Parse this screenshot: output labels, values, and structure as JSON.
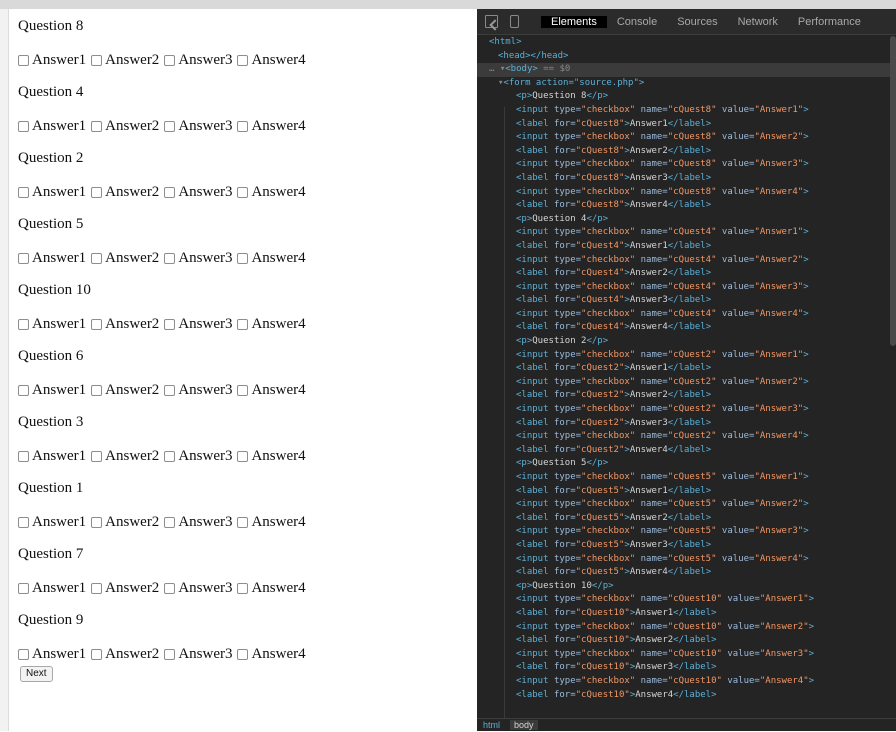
{
  "page": {
    "questions": [
      {
        "title": "Question 8",
        "answers": [
          "Answer1",
          "Answer2",
          "Answer3",
          "Answer4"
        ]
      },
      {
        "title": "Question 4",
        "answers": [
          "Answer1",
          "Answer2",
          "Answer3",
          "Answer4"
        ]
      },
      {
        "title": "Question 2",
        "answers": [
          "Answer1",
          "Answer2",
          "Answer3",
          "Answer4"
        ]
      },
      {
        "title": "Question 5",
        "answers": [
          "Answer1",
          "Answer2",
          "Answer3",
          "Answer4"
        ]
      },
      {
        "title": "Question 10",
        "answers": [
          "Answer1",
          "Answer2",
          "Answer3",
          "Answer4"
        ]
      },
      {
        "title": "Question 6",
        "answers": [
          "Answer1",
          "Answer2",
          "Answer3",
          "Answer4"
        ]
      },
      {
        "title": "Question 3",
        "answers": [
          "Answer1",
          "Answer2",
          "Answer3",
          "Answer4"
        ]
      },
      {
        "title": "Question 1",
        "answers": [
          "Answer1",
          "Answer2",
          "Answer3",
          "Answer4"
        ]
      },
      {
        "title": "Question 7",
        "answers": [
          "Answer1",
          "Answer2",
          "Answer3",
          "Answer4"
        ]
      },
      {
        "title": "Question 9",
        "answers": [
          "Answer1",
          "Answer2",
          "Answer3",
          "Answer4"
        ]
      }
    ],
    "next_label": "Next"
  },
  "devtools": {
    "tabs": [
      "Elements",
      "Console",
      "Sources",
      "Network",
      "Performance"
    ],
    "active_tab": "Elements",
    "icons": [
      "inspect-element-icon",
      "device-toolbar-icon"
    ],
    "tree_head": [
      {
        "indent": 0,
        "html": "<html>"
      },
      {
        "indent": 1,
        "html": "<head></head>"
      },
      {
        "indent": 0,
        "prefix": "… ▾",
        "html": "<body>",
        "suffix": " == $0",
        "selected": true
      },
      {
        "indent": 1,
        "prefix": "▾",
        "html": "<form action=\"source.php\">"
      }
    ],
    "tree_questions": [
      {
        "text": "Question 8",
        "name": "cQuest8"
      },
      {
        "text": "Question 4",
        "name": "cQuest4"
      },
      {
        "text": "Question 2",
        "name": "cQuest2"
      },
      {
        "text": "Question 5",
        "name": "cQuest5"
      },
      {
        "text": "Question 10",
        "name": "cQuest10"
      }
    ],
    "answer_values": [
      "Answer1",
      "Answer2",
      "Answer3",
      "Answer4"
    ],
    "breadcrumb": [
      "html",
      "body"
    ],
    "colors": {
      "tag": "#5db0d7",
      "attr": "#9bbbdc",
      "value": "#f29766",
      "background": "#242424"
    }
  }
}
